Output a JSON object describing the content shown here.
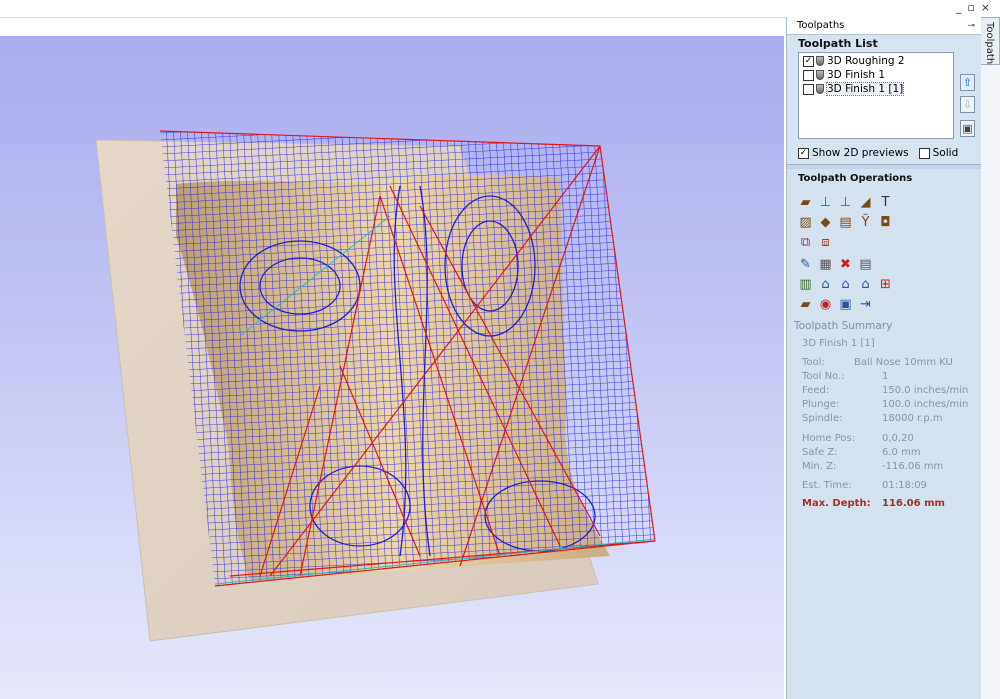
{
  "panel": {
    "title": "Toolpaths",
    "tab_label": "Toolpaths",
    "pin_icon": "pin-icon"
  },
  "window": {
    "controls": [
      "_",
      "▫",
      "×"
    ]
  },
  "toolpath_list": {
    "heading": "Toolpath List",
    "items": [
      {
        "label": "3D Roughing 2",
        "checked": true,
        "selected": false
      },
      {
        "label": "3D Finish 1",
        "checked": false,
        "selected": false
      },
      {
        "label": "3D Finish 1 [1]",
        "checked": false,
        "selected": true
      }
    ],
    "side_buttons": [
      "move-up-icon",
      "move-down-icon",
      "delete-icon"
    ]
  },
  "options": {
    "show_2d_previews": {
      "label": "Show 2D previews",
      "checked": true
    },
    "solid": {
      "label": "Solid",
      "checked": false
    }
  },
  "operations": {
    "heading": "Toolpath Operations",
    "icons": [
      [
        "profile-icon",
        "pocket-icon",
        "drill-icon",
        "vcarve-icon",
        "text-icon"
      ],
      [
        "texture-icon",
        "prism-icon",
        "fluting-icon",
        "inlay-icon",
        "moulding-icon"
      ],
      [
        "roughing-icon",
        "finishing-icon"
      ],
      [
        "edit-icon",
        "copy-icon",
        "delete-icon",
        "template-icon"
      ],
      [
        "merge-icon",
        "recalc-icon",
        "summary-icon",
        "layout-icon",
        "sheet-icon"
      ],
      [
        "preview-icon",
        "timer-icon",
        "save-icon",
        "export-icon"
      ]
    ]
  },
  "summary": {
    "heading": "Toolpath Summary",
    "name": "3D Finish 1 [1]",
    "rows": [
      {
        "key": "Tool:",
        "value": "Ball Nose 10mm KU"
      },
      {
        "key": "Tool No.:",
        "value": "1"
      },
      {
        "key": "Feed:",
        "value": "150.0 inches/min"
      },
      {
        "key": "Plunge:",
        "value": "100.0 inches/min"
      },
      {
        "key": "Spindle:",
        "value": "18000 r.p.m"
      },
      {
        "key": "Home Pos:",
        "value": "0,0,20"
      },
      {
        "key": "Safe Z:",
        "value": "6.0 mm"
      },
      {
        "key": "Min. Z:",
        "value": "-116.06 mm"
      },
      {
        "key": "Est. Time:",
        "value": "01:18:09"
      },
      {
        "key": "Max. Depth:",
        "value": "116.06 mm"
      }
    ]
  },
  "colors": {
    "toolpath_blue": "#1a1ae6",
    "rapid_red": "#e01818",
    "material": "#e8d9c3",
    "background_top": "#a9abf0",
    "max_depth": "#a0302a"
  }
}
